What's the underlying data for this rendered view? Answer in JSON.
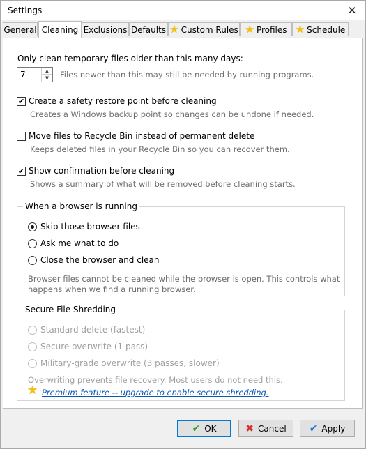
{
  "window": {
    "title": "Settings",
    "close_glyph": "✕"
  },
  "tabs": [
    {
      "label": "General"
    },
    {
      "label": "Cleaning"
    },
    {
      "label": "Exclusions"
    },
    {
      "label": "Defaults"
    },
    {
      "label": "Custom Rules",
      "icon": "star-icon"
    },
    {
      "label": "Profiles",
      "icon": "star-icon"
    },
    {
      "label": "Schedule",
      "icon": "star-icon"
    }
  ],
  "active_tab": "Cleaning",
  "cleaning": {
    "days_label": "Only clean temporary files older than this many days:",
    "days_value": "7",
    "days_hint": "Files newer than this may still be needed by running programs.",
    "options": [
      {
        "label": "Create a safety restore point before cleaning",
        "checked": true,
        "hint": "Creates a Windows backup point so changes can be undone if needed."
      },
      {
        "label": "Move files to Recycle Bin instead of permanent delete",
        "checked": false,
        "hint": "Keeps deleted files in your Recycle Bin so you can recover them."
      },
      {
        "label": "Show confirmation before cleaning",
        "checked": true,
        "hint": "Shows a summary of what will be removed before cleaning starts."
      }
    ],
    "browser_group": {
      "title": "When a browser is running",
      "radios": [
        {
          "label": "Skip those browser files",
          "selected": true
        },
        {
          "label": "Ask me what to do",
          "selected": false
        },
        {
          "label": "Close the browser and clean",
          "selected": false
        }
      ],
      "note_line1": "Browser files cannot be cleaned while the browser is open. This controls what",
      "note_line2": "happens when we find a running browser."
    },
    "shred_group": {
      "title": "Secure File Shredding",
      "radios": [
        {
          "label": "Standard delete (fastest)",
          "enabled": false
        },
        {
          "label": "Secure overwrite (1 pass)",
          "enabled": false
        },
        {
          "label": "Military-grade overwrite (3 passes, slower)",
          "enabled": false
        }
      ],
      "note": "Overwriting prevents file recovery. Most users do not need this.",
      "premium_link": "Premium feature -- upgrade to enable secure shredding."
    }
  },
  "buttons": {
    "ok": "OK",
    "cancel": "Cancel",
    "apply": "Apply"
  },
  "colors": {
    "accent": "#0078d7",
    "star": "#f4c20d",
    "link": "#0a58b5",
    "ok_check": "#2f9e2f",
    "cancel_x": "#d32f2f",
    "apply_check": "#1e6fd9"
  }
}
